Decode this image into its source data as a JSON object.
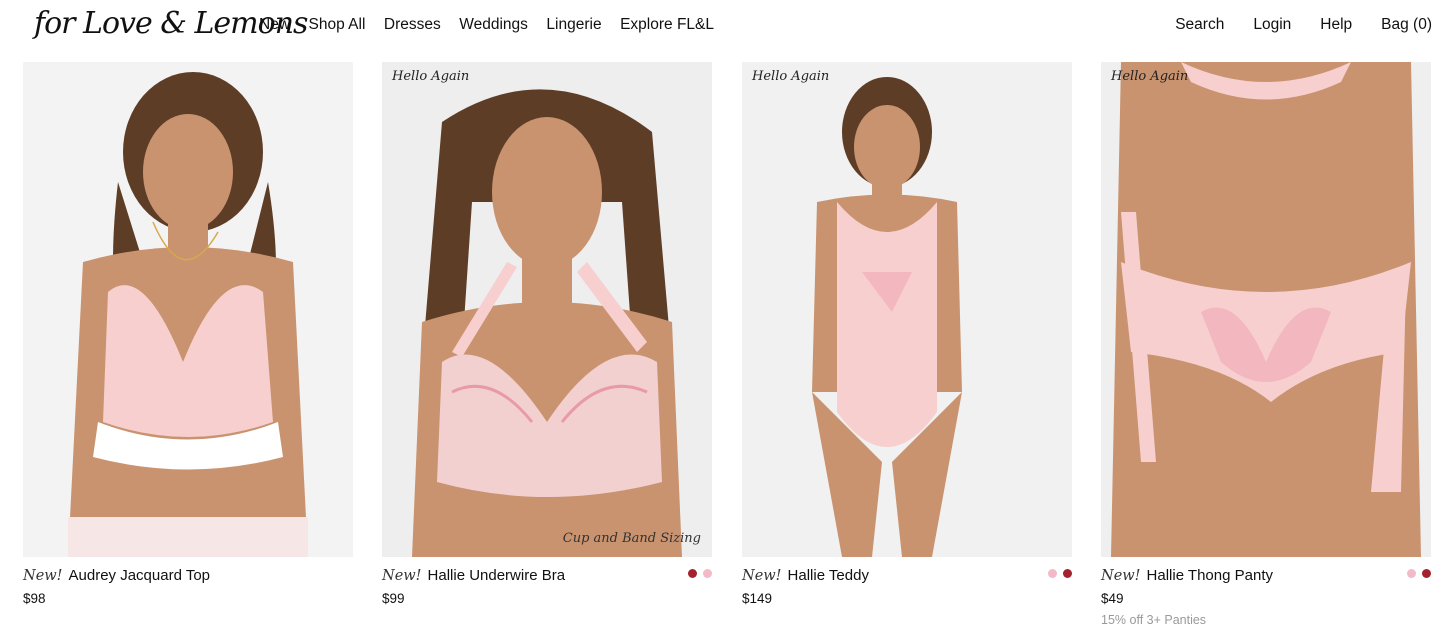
{
  "brand": {
    "logo_text": "for Love & Lemons"
  },
  "nav": {
    "items": [
      "New",
      "Shop All",
      "Dresses",
      "Weddings",
      "Lingerie",
      "Explore FL&L"
    ]
  },
  "utility": {
    "search": "Search",
    "login": "Login",
    "help": "Help",
    "bag": "Bag (0)"
  },
  "colors": {
    "pink_swatch": "#f2b9c9",
    "red_swatch": "#a3222d",
    "background": "#ffffff"
  },
  "products": [
    {
      "badge": "",
      "corner_label": "",
      "new_label": "New!",
      "name": "Audrey Jacquard Top",
      "price": "$98",
      "promo": "",
      "swatches": []
    },
    {
      "badge": "Hello Again",
      "corner_label": "Cup and Band Sizing",
      "new_label": "New!",
      "name": "Hallie Underwire Bra",
      "price": "$99",
      "promo": "",
      "swatches": [
        "red",
        "pink"
      ]
    },
    {
      "badge": "Hello Again",
      "corner_label": "",
      "new_label": "New!",
      "name": "Hallie Teddy",
      "price": "$149",
      "promo": "",
      "swatches": [
        "pink",
        "red"
      ]
    },
    {
      "badge": "Hello Again",
      "corner_label": "",
      "new_label": "New!",
      "name": "Hallie Thong Panty",
      "price": "$49",
      "promo": "15% off 3+ Panties",
      "swatches": [
        "pink",
        "red"
      ]
    }
  ]
}
